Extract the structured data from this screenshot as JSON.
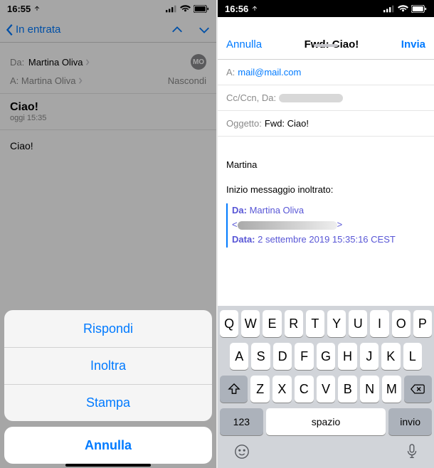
{
  "left": {
    "time": "16:55",
    "nav_back": "In entrata",
    "from_label": "Da:",
    "from_value": "Martina Oliva",
    "to_label": "A:",
    "to_value": "Martina Oliva",
    "hide": "Nascondi",
    "avatar": "MO",
    "subject": "Ciao!",
    "date": "oggi 15:35",
    "body": "Ciao!",
    "sheet": {
      "reply": "Rispondi",
      "forward": "Inoltra",
      "print": "Stampa",
      "cancel": "Annulla"
    }
  },
  "right": {
    "time": "16:56",
    "cancel": "Annulla",
    "title": "Fwd: Ciao!",
    "send": "Invia",
    "to_label": "A:",
    "to_value": "mail@mail.com",
    "cc_label": "Cc/Ccn, Da:",
    "subject_label": "Oggetto:",
    "subject_value": "Fwd: Ciao!",
    "body_greeting": "Martina",
    "body_fwd_intro": "Inizio messaggio inoltrato:",
    "quote_from_label": "Da:",
    "quote_from_value": "Martina Oliva",
    "quote_date_label": "Data:",
    "quote_date_value": "2 settembre 2019 15:35:16 CEST",
    "keyboard": {
      "row1": [
        "Q",
        "W",
        "E",
        "R",
        "T",
        "Y",
        "U",
        "I",
        "O",
        "P"
      ],
      "row2": [
        "A",
        "S",
        "D",
        "F",
        "G",
        "H",
        "J",
        "K",
        "L"
      ],
      "row3": [
        "Z",
        "X",
        "C",
        "V",
        "B",
        "N",
        "M"
      ],
      "num": "123",
      "space": "spazio",
      "enter": "invio"
    }
  }
}
